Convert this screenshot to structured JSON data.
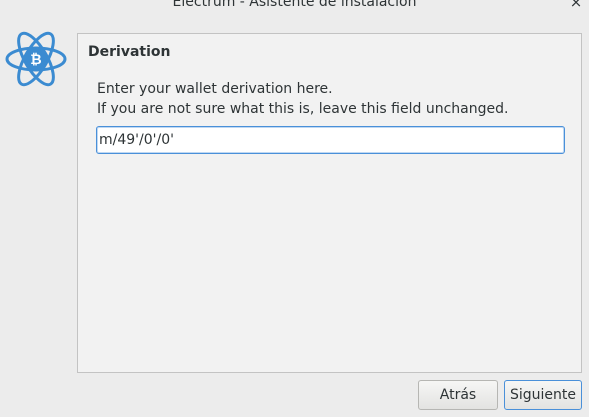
{
  "window": {
    "title": "Electrum  -  Asistente de instalación",
    "close_glyph": "×"
  },
  "logo": {
    "icon": "electrum-logo-icon",
    "color": "#3b8bd1"
  },
  "panel": {
    "title": "Derivation",
    "description_line1": "Enter your wallet derivation here.",
    "description_line2": "If you are not sure what this is, leave this field unchanged.",
    "derivation_value": "m/49'/0'/0'"
  },
  "buttons": {
    "back_label": "Atrás",
    "next_label": "Siguiente"
  },
  "colors": {
    "accent": "#4a90d9",
    "background": "#ececec",
    "panel_background": "#f2f2f2"
  }
}
